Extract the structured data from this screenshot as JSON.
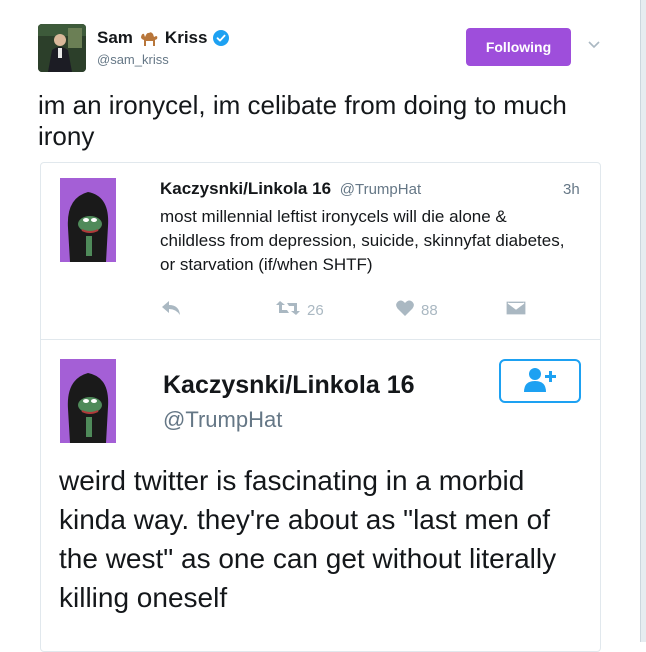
{
  "author": {
    "name_first": "Sam",
    "name_last": "Kriss",
    "handle": "@sam_kriss",
    "follow_label": "Following"
  },
  "tweet": {
    "text": "im an ironycel, im celibate from doing to much irony"
  },
  "quoted_tweet": {
    "name": "Kaczysnki/Linkola 16",
    "handle": "@TrumpHat",
    "time": "3h",
    "text": "most millennial leftist ironycels will die alone & childless from depression, suicide, skinnyfat diabetes, or starvation (if/when SHTF)",
    "retweets": "26",
    "likes": "88"
  },
  "embedded_screenshot": {
    "name": "Kaczysnki/Linkola 16",
    "handle": "@TrumpHat",
    "text": "weird twitter is fascinating in a morbid kinda way. they're about as \"last men of the west\" as one can get without literally killing oneself"
  },
  "colors": {
    "accent_purple": "#9e4edb",
    "twitter_blue": "#1da1f2",
    "verified_blue": "#1da1f2",
    "muted": "#657786",
    "icon_gray": "#aab8c2",
    "avatar_purple": "#a45fd6"
  },
  "icons": [
    "camel-icon",
    "verified-badge-icon",
    "chevron-down-icon",
    "reply-icon",
    "retweet-icon",
    "like-icon",
    "dm-icon",
    "follow-person-icon"
  ]
}
